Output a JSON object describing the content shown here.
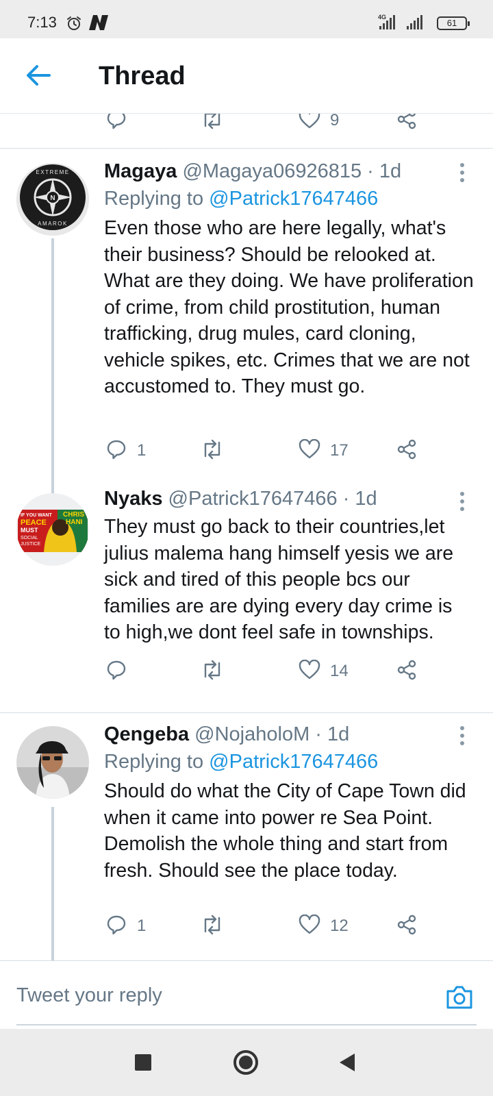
{
  "status_bar": {
    "time": "7:13",
    "network": "4G",
    "battery": "61",
    "icons": [
      "alarm-icon",
      "n-app-icon",
      "signal-icon",
      "battery-icon"
    ]
  },
  "header": {
    "back_icon": "back-arrow-icon",
    "title": "Thread"
  },
  "top_actions": {
    "reply_count": "",
    "retweet_count": "",
    "like_count": "9"
  },
  "tweets": [
    {
      "name": "Magaya",
      "handle": "@Magaya06926815",
      "time": "· 1d",
      "replying_prefix": "Replying to",
      "replying_handle": "@Patrick17647466",
      "avatar_text": "EXTREME AMAROK",
      "body": "Even those who are here legally,  what's their business? Should be relooked at. What are they doing. We have proliferation of crime, from child prostitution,  human trafficking,  drug mules, card cloning, vehicle spikes, etc. Crimes that we are not accustomed to. They must go.",
      "reply_count": "1",
      "retweet_count": "",
      "like_count": "17"
    },
    {
      "name": "Nyaks",
      "handle": "@Patrick17647466",
      "time": "· 1d",
      "avatar_text_left": "IF YOU WANT PEACE THEN YOU MUST STRUGGLE FOR SOCIAL JUSTICE",
      "avatar_text_right": "CHRIS HANI",
      "body": "They must go back to their countries,let julius malema hang himself yesis we are sick and tired of this people bcs our families are are dying every day crime is to high,we dont feel safe in townships.",
      "reply_count": "",
      "retweet_count": "",
      "like_count": "14"
    },
    {
      "name": "Qengeba",
      "handle": "@NojaholoM",
      "time": "· 1d",
      "replying_prefix": "Replying to",
      "replying_handle": "@Patrick17647466",
      "body": "Should do what the City of Cape Town did when it came into power re Sea Point. Demolish the whole thing and start from fresh. Should see the place today.",
      "reply_count": "1",
      "retweet_count": "",
      "like_count": "12"
    }
  ],
  "compose": {
    "placeholder": "Tweet your reply",
    "camera_icon": "camera-icon"
  },
  "nav": {
    "icons": [
      "recents-square-icon",
      "home-circle-icon",
      "back-triangle-icon"
    ]
  },
  "colors": {
    "accent": "#1b95e0",
    "text": "#14171a",
    "muted": "#657786",
    "divider": "#d6dde3",
    "thread_line": "#c8d2da"
  }
}
